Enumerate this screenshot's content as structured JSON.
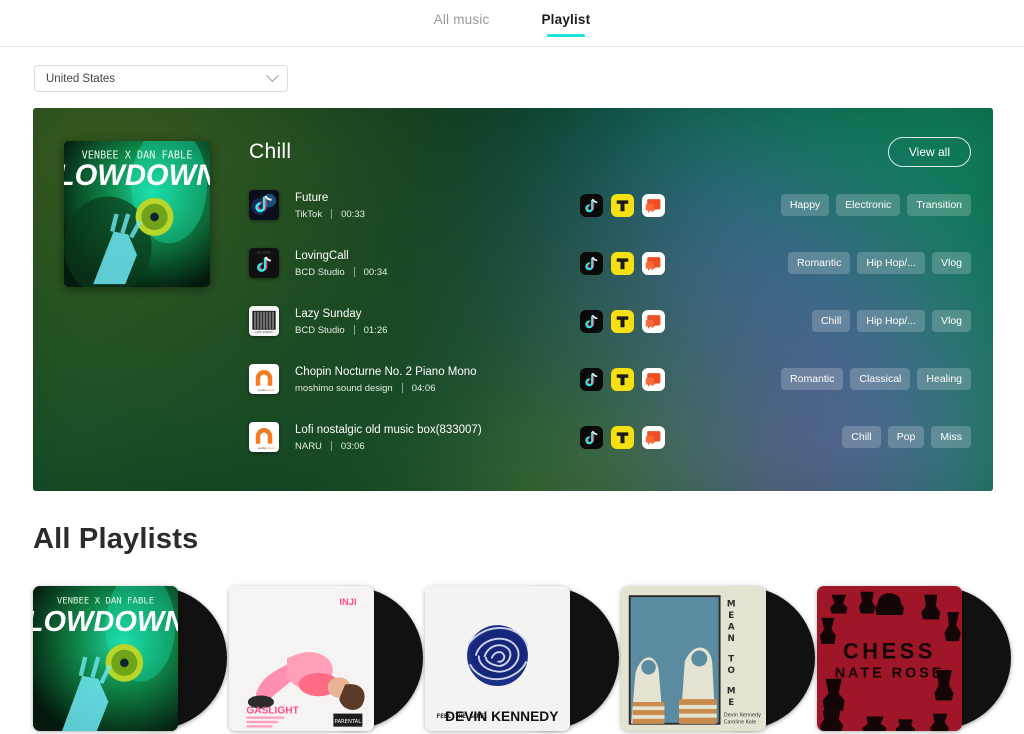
{
  "nav": {
    "tabs": [
      {
        "label": "All music",
        "active": false
      },
      {
        "label": "Playlist",
        "active": true
      }
    ]
  },
  "filter": {
    "country_value": "United States",
    "chevron_icon": "chevron-down-icon"
  },
  "featured": {
    "title": "Chill",
    "view_all_label": "View all",
    "cover": {
      "artist_line": "VENBEE X DAN FABLE",
      "title_line": "LOW DOWN"
    },
    "tracks": [
      {
        "name": "Future",
        "source": "TikTok",
        "duration": "00:33",
        "thumb": "tiktok-neon-icon",
        "platforms": [
          "tiktok-icon",
          "yellow-t-icon",
          "kakao-icon"
        ],
        "tags": [
          "Happy",
          "Electronic",
          "Transition"
        ]
      },
      {
        "name": "LovingCall",
        "source": "BCD Studio",
        "duration": "00:34",
        "thumb": "tiktok-dark-icon",
        "platforms": [
          "tiktok-icon",
          "yellow-t-icon",
          "kakao-icon"
        ],
        "tags": [
          "Romantic",
          "Hip Hop/...",
          "Vlog"
        ]
      },
      {
        "name": "Lazy Sunday",
        "source": "BCD Studio",
        "duration": "01:26",
        "thumb": "photo-bw-icon",
        "platforms": [
          "tiktok-icon",
          "yellow-t-icon",
          "kakao-icon"
        ],
        "tags": [
          "Chill",
          "Hip Hop/...",
          "Vlog"
        ]
      },
      {
        "name": "Chopin Nocturne No. 2 Piano Mono",
        "source": "moshimo sound design",
        "duration": "04:06",
        "thumb": "audiostock-icon",
        "platforms": [
          "tiktok-icon",
          "yellow-t-icon",
          "kakao-icon"
        ],
        "tags": [
          "Romantic",
          "Classical",
          "Healing"
        ]
      },
      {
        "name": "Lofi nostalgic old music box(833007)",
        "source": "NARU",
        "duration": "03:06",
        "thumb": "audiostock-icon",
        "platforms": [
          "tiktok-icon",
          "yellow-t-icon",
          "kakao-icon"
        ],
        "tags": [
          "Chill",
          "Pop",
          "Miss"
        ]
      }
    ]
  },
  "all_playlists": {
    "heading": "All Playlists",
    "cards": [
      {
        "art": "low-down",
        "artist": "VENBEE X DAN FABLE",
        "title": "LOW DOWN"
      },
      {
        "art": "gaslight",
        "artist": "INJI",
        "title": "GASLIGHT"
      },
      {
        "art": "feel-the-same",
        "artist": "DEVIN KENNEDY",
        "title": "FEEL THE SAME."
      },
      {
        "art": "mean-to-me",
        "artist": "Devin Kennedy / Caroline Kole",
        "title": "MEAN TO ME"
      },
      {
        "art": "chess",
        "artist": "NATE ROSE",
        "title": "CHESS"
      }
    ]
  },
  "colors": {
    "accent": "#21e1e1",
    "tab_active": "#1c1c1c",
    "tab_inactive": "#9a9a9a",
    "heading": "#2b2b2b",
    "tiktok_cyan": "#25f4ee",
    "tiktok_pink": "#fe2c55",
    "yellow": "#f7e011",
    "kakao_red": "#f04e23",
    "chess_red": "#a9192a"
  }
}
